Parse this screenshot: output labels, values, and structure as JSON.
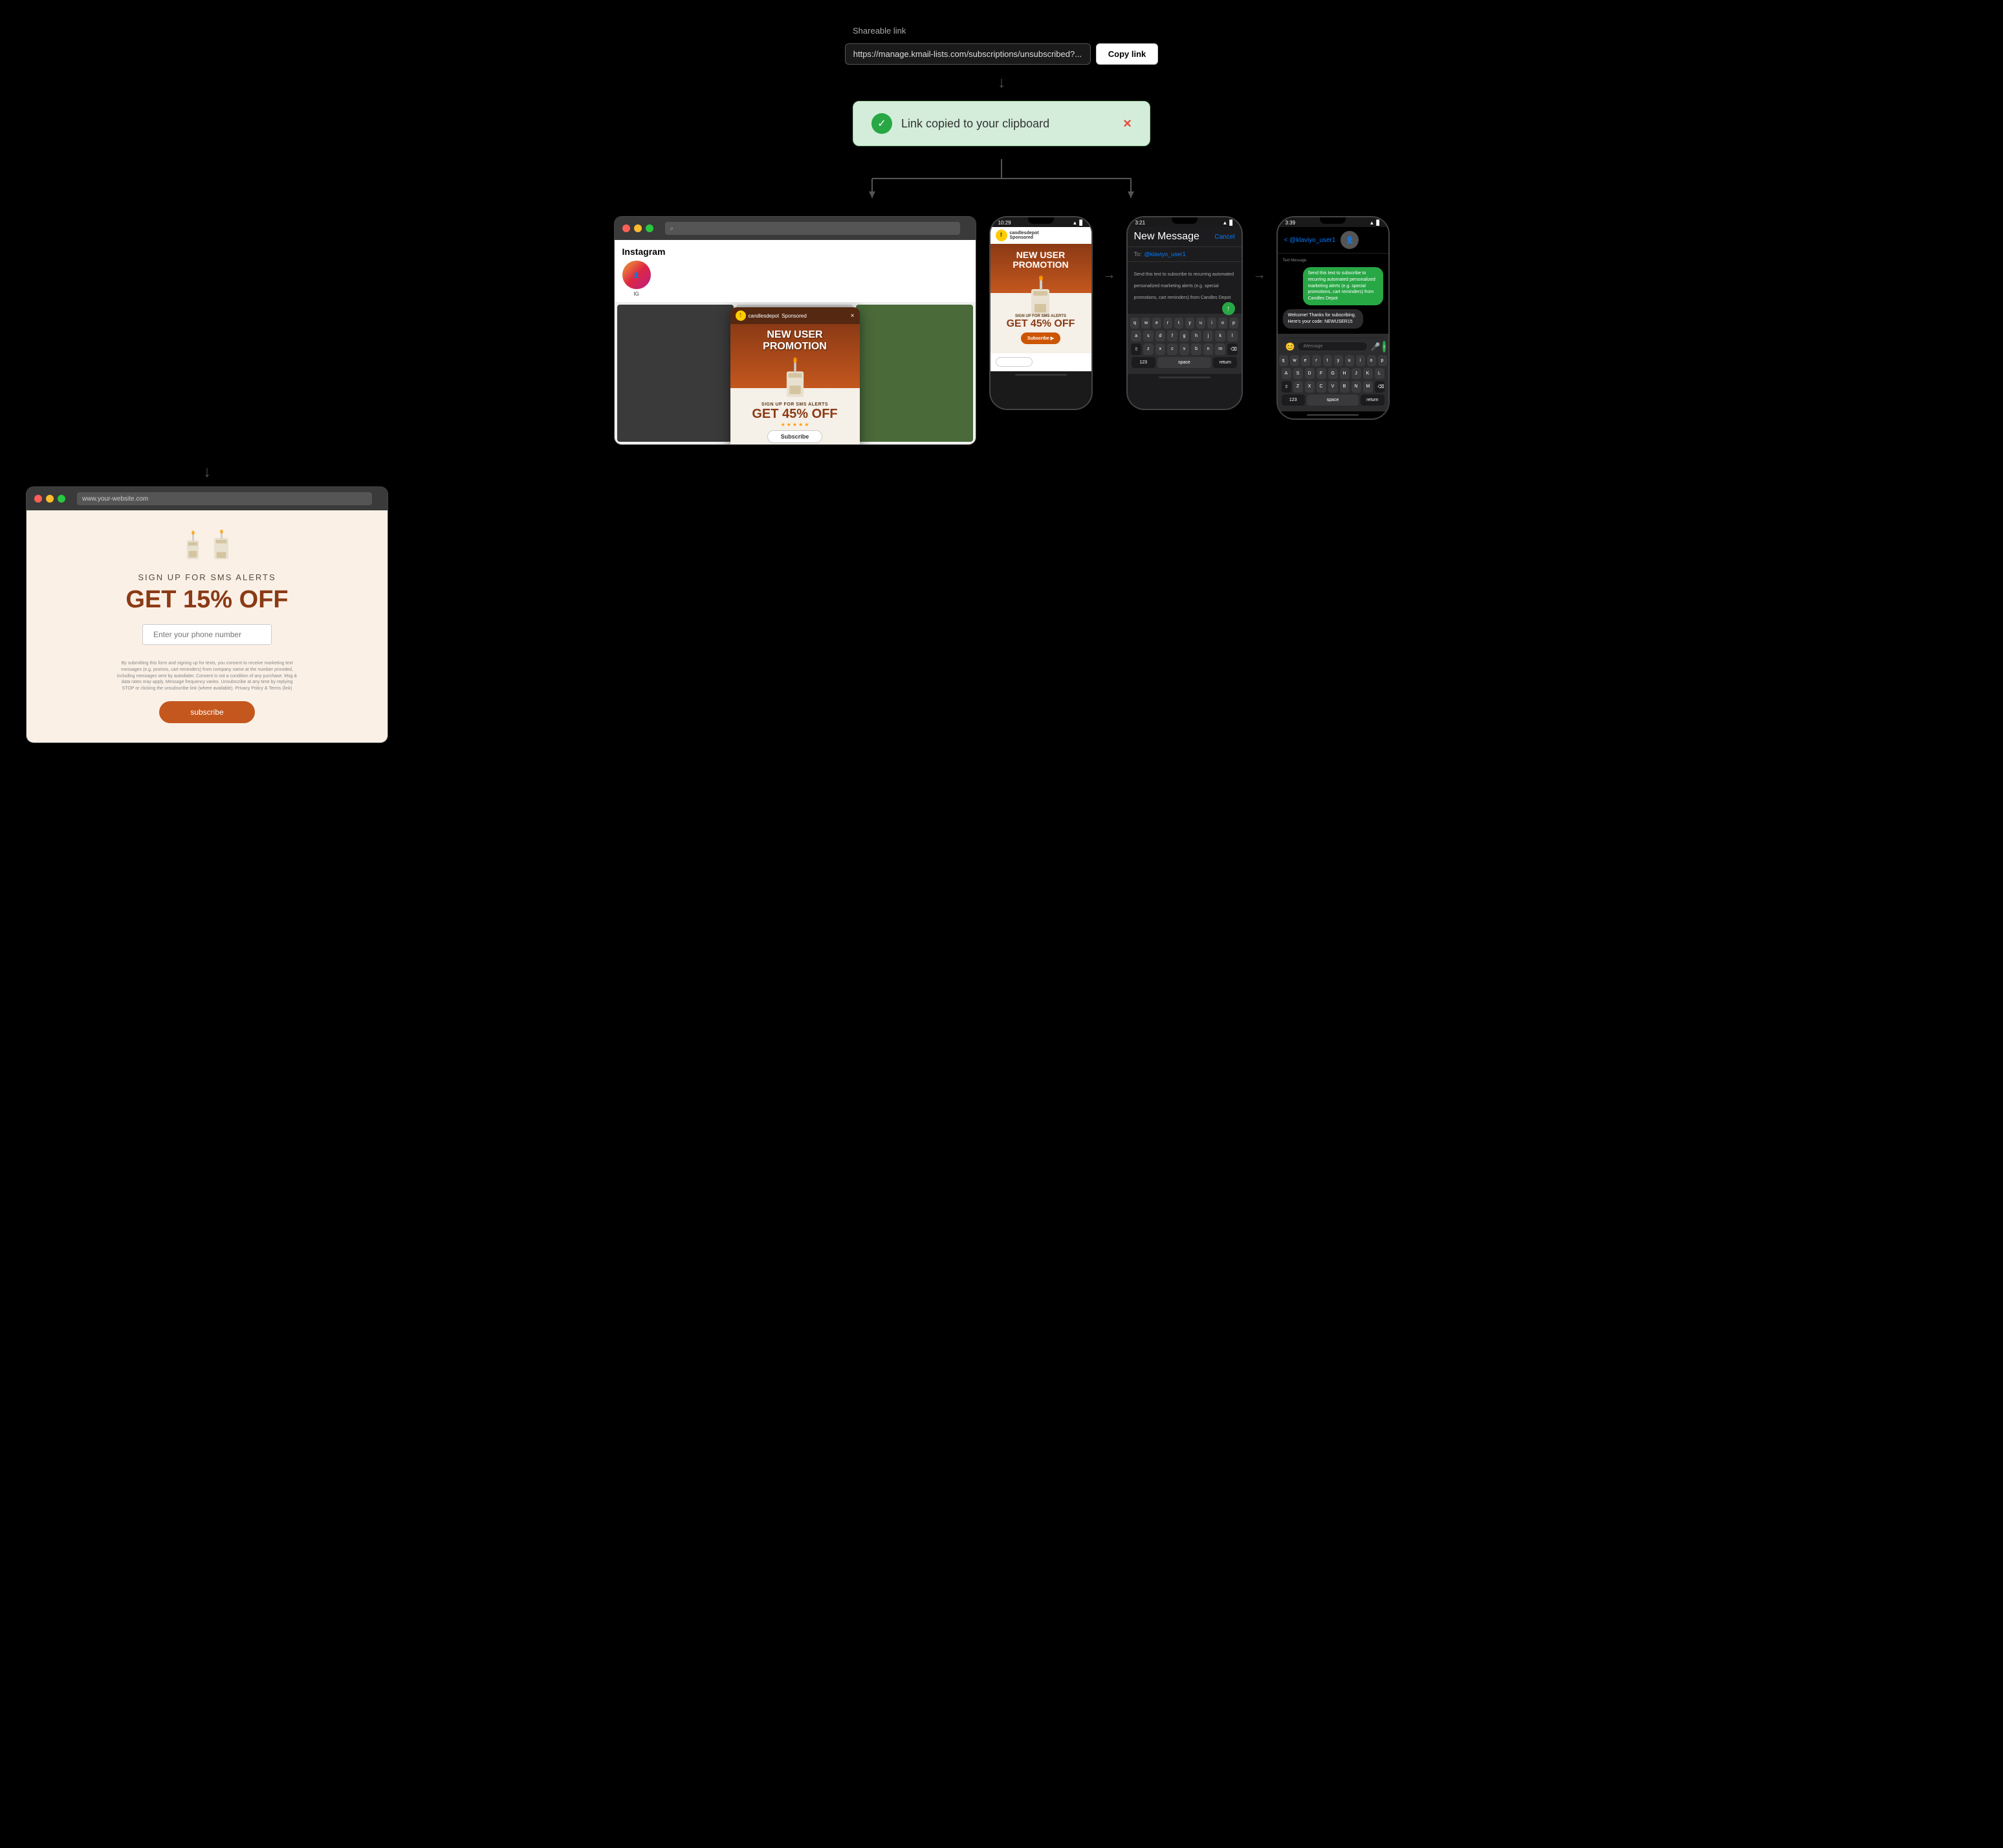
{
  "shareable": {
    "label": "Shareable link",
    "url": "https://manage.kmail-lists.com/subscriptions/unsubscribed?...",
    "copy_btn": "Copy link"
  },
  "toast": {
    "message": "Link copied to your clipboard",
    "close_label": "×"
  },
  "ig_popup": {
    "brand": "candlesdepot",
    "sponsored": "Sponsored",
    "title_line1": "NEW USER",
    "title_line2": "PROMOTION",
    "sub_text": "SIGN UP FOR SMS ALERTS",
    "discount": "GET 45% OFF",
    "subscribe_btn": "Subscribe",
    "close": "×"
  },
  "phone1": {
    "time": "10:29",
    "brand": "candlesdepot",
    "sponsored": "Sponsored",
    "title_line1": "NEW USER",
    "title_line2": "PROMOTION",
    "sub_text": "SIGN UP FOR SMS ALERTS",
    "discount": "GET 45% OFF",
    "subscribe_btn": "Subscribe"
  },
  "phone2": {
    "time": "3:21",
    "title": "New Message",
    "cancel": "Cancel",
    "to_label": "To:",
    "to_value": "@klaviyo_user1",
    "body_text": "Send this text to subscribe to recurring automated personalized marketing alerts (e.g. special promotions, cart reminders) from Candles Depot",
    "keys_row1": [
      "q",
      "w",
      "e",
      "r",
      "t",
      "y",
      "u",
      "i",
      "o",
      "p"
    ],
    "keys_row2": [
      "a",
      "s",
      "d",
      "f",
      "g",
      "h",
      "j",
      "k",
      "l"
    ],
    "keys_row3": [
      "z",
      "x",
      "c",
      "v",
      "b",
      "n",
      "m"
    ],
    "space": "space",
    "return": "return"
  },
  "phone3": {
    "time": "3:39",
    "back": "< @klaviyo_user1",
    "text_message_label": "Text Message",
    "sent_text": "Send this text to subscribe to recurring automated personalized marketing alerts (e.g. special promotions, cart reminders) from Candles Depot",
    "received_text": "Welcome! Thanks for subscribing. Here's your code: NEWUSER15",
    "input_placeholder": "iMessage",
    "keys_row1": [
      "q",
      "w",
      "e",
      "r",
      "t",
      "y",
      "u",
      "i",
      "o",
      "p"
    ],
    "keys_row2": [
      "a",
      "s",
      "d",
      "f",
      "g",
      "h",
      "j",
      "k",
      "l"
    ],
    "keys_row3": [
      "z",
      "x",
      "c",
      "v",
      "b",
      "n",
      "m"
    ],
    "space": "space",
    "return": "return"
  },
  "landing": {
    "url": "www.your-website.com",
    "heading": "SIGN UP FOR SMS ALERTS",
    "discount": "GET 15% OFF",
    "phone_placeholder": "Enter your phone number",
    "legal_text": "By submitting this form and signing up for texts, you consent to receive marketing text messages (e.g. promos, cart reminders) from company name at the number provided, including messages sent by autodialer. Consent is not a condition of any purchase. Msg & data rates may apply. Message frequency varies. Unsubscribe at any time by replying STOP or clicking the unsubscribe link (where available). Privacy Policy & Terms (link)",
    "subscribe_btn": "subscribe"
  }
}
